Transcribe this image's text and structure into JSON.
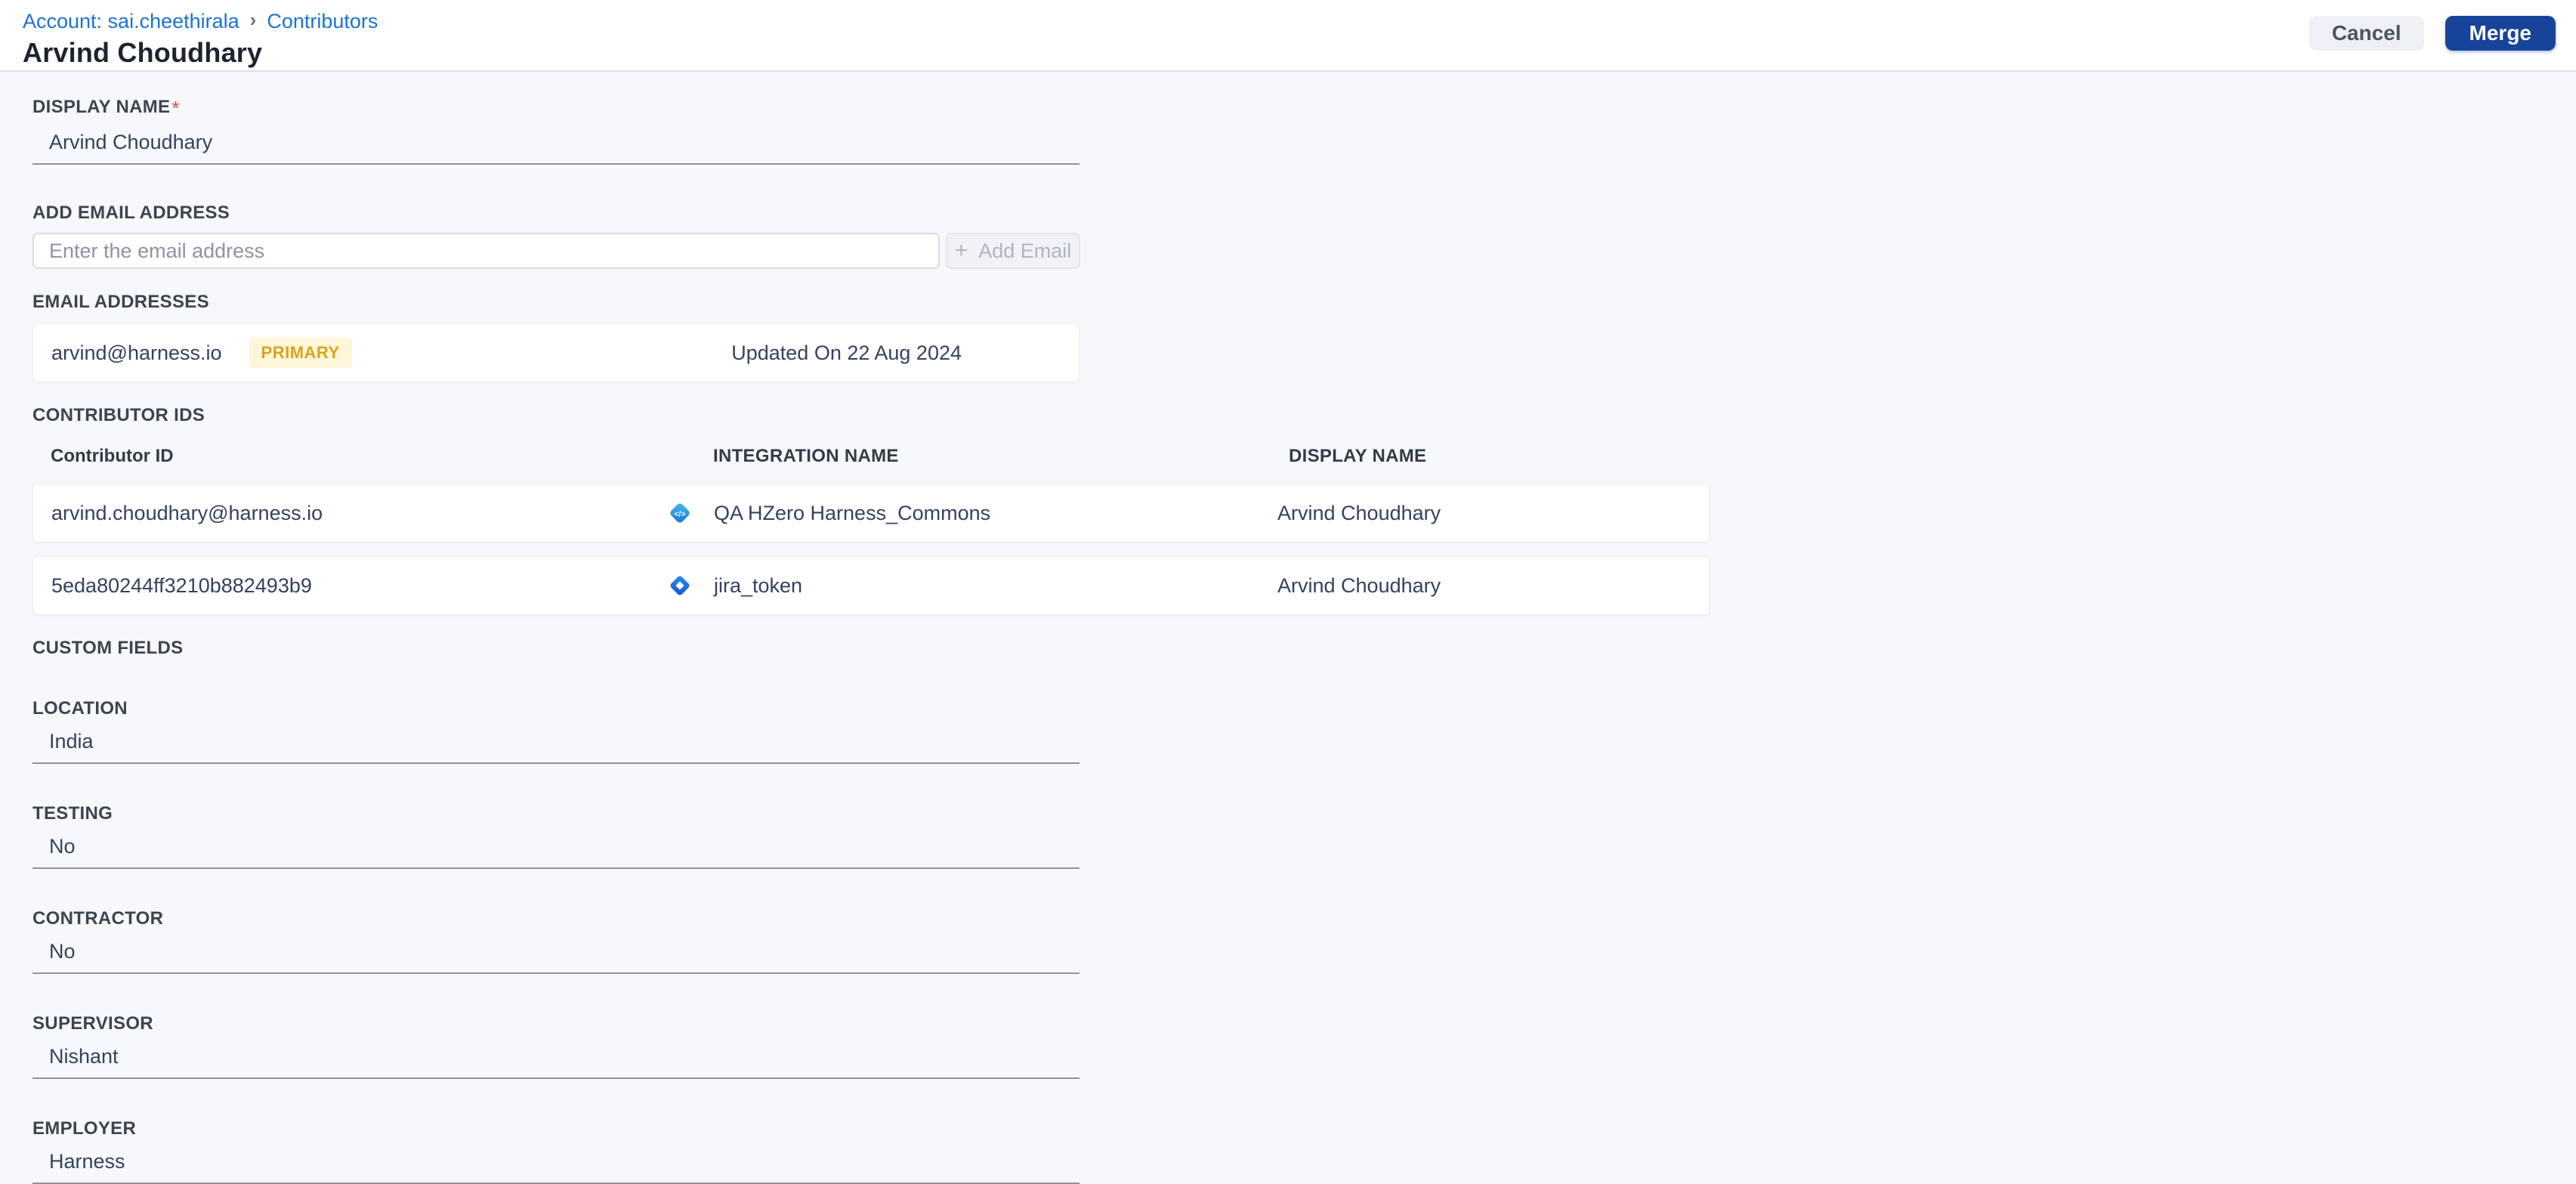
{
  "breadcrumb": {
    "account_link": "Account: sai.cheethirala",
    "separator": "›",
    "current_link": "Contributors"
  },
  "header": {
    "title": "Arvind Choudhary",
    "cancel_label": "Cancel",
    "merge_label": "Merge"
  },
  "form": {
    "display_name": {
      "label": "DISPLAY NAME",
      "required_mark": "*",
      "value": "Arvind Choudhary"
    },
    "add_email": {
      "label": "ADD EMAIL ADDRESS",
      "placeholder": "Enter the email address",
      "plus_icon": "+",
      "button_label": "Add Email"
    },
    "email_addresses": {
      "label": "EMAIL ADDRESSES",
      "items": [
        {
          "email": "arvind@harness.io",
          "badge": "PRIMARY",
          "updated": "Updated On 22 Aug 2024"
        }
      ]
    },
    "contributor_ids": {
      "label": "CONTRIBUTOR IDS",
      "columns": [
        "Contributor ID",
        "INTEGRATION NAME",
        "DISPLAY NAME"
      ],
      "rows": [
        {
          "contributor_id": "arvind.choudhary@harness.io",
          "integration_icon": "code-integration-icon",
          "integration_name": "QA HZero Harness_Commons",
          "display_name": "Arvind Choudhary"
        },
        {
          "contributor_id": "5eda80244ff3210b882493b9",
          "integration_icon": "jira-icon",
          "integration_name": "jira_token",
          "display_name": "Arvind Choudhary"
        }
      ]
    },
    "custom_fields": {
      "label": "CUSTOM FIELDS",
      "fields": [
        {
          "label": "LOCATION",
          "value": "India"
        },
        {
          "label": "TESTING",
          "value": "No"
        },
        {
          "label": "CONTRACTOR",
          "value": "No"
        },
        {
          "label": "SUPERVISOR",
          "value": "Nishant"
        },
        {
          "label": "EMPLOYER",
          "value": "Harness"
        }
      ]
    }
  },
  "colors": {
    "body_background": "#f7f8fb",
    "header_background": "#ffffff",
    "primary_button": "#17439a",
    "cancel_button": "#eff0f6",
    "link_blue": "#1a73d3",
    "badge_background": "#fdf6d8",
    "badge_text": "#d7a421",
    "required_red": "#e5484d",
    "value_text": "#33425f",
    "label_text": "#3c4450",
    "underline_gray": "#90939a"
  }
}
